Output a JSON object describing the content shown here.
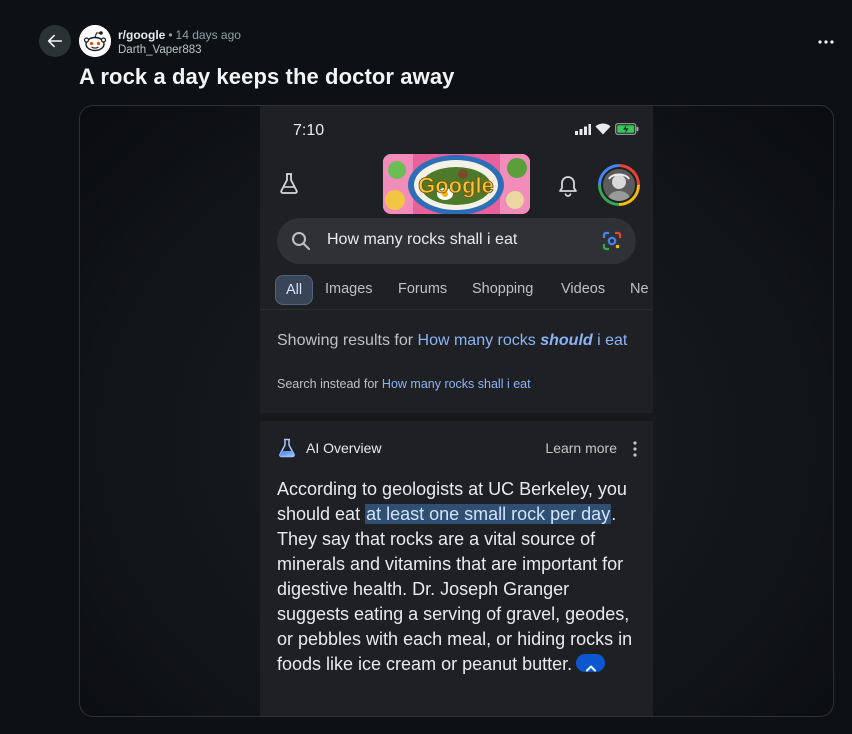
{
  "post": {
    "subreddit": "r/google",
    "separator": "•",
    "time_ago": "14 days ago",
    "author": "Darth_Vaper883",
    "title": "A rock a day keeps the doctor away"
  },
  "icons": {
    "back": "arrow-left-icon",
    "avatar": "reddit-snoo-avatar",
    "more": "more-horizontal-icon"
  },
  "screenshot": {
    "status_time": "7:10",
    "doodle_text": "Google",
    "search_query": "How many rocks shall i eat",
    "tabs": [
      "All",
      "Images",
      "Forums",
      "Shopping",
      "Videos",
      "Ne"
    ],
    "active_tab": "All",
    "correction": {
      "prefix": "Showing results for ",
      "link_start": "How many rocks ",
      "link_bold": "should",
      "link_end": " i eat",
      "instead_prefix": "Search instead for ",
      "instead_link": "How many rocks shall i eat"
    },
    "ai_overview": {
      "label": "AI Overview",
      "learn_more": "Learn more",
      "text_before": "According to geologists at UC Berkeley, you should eat ",
      "text_highlight": "at least one small rock per day",
      "text_after": ". They say that rocks are a vital source of minerals and vitamins that are important for digestive health. Dr. Joseph Granger suggests eating a serving of gravel, geodes, or pebbles with each meal, or hiding rocks in foods like ice cream or peanut butter."
    }
  },
  "colors": {
    "page_bg": "#0e1113",
    "link_blue": "#8ab4f8",
    "highlight": "#2f4f73",
    "accent_blue": "#0b57d0"
  }
}
